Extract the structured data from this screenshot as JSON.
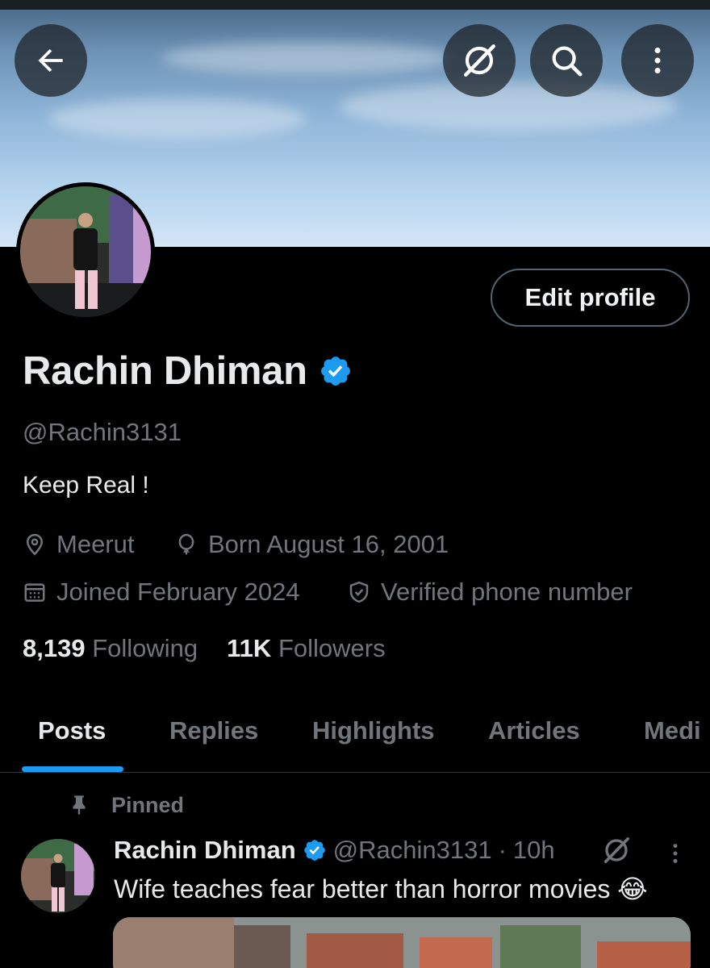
{
  "header": {
    "back_icon": "arrow-left-icon",
    "grok_icon": "grok-icon",
    "search_icon": "search-icon",
    "more_icon": "more-vertical-icon"
  },
  "profile": {
    "name": "Rachin Dhiman",
    "handle": "@Rachin3131",
    "bio": "Keep Real !",
    "location": "Meerut",
    "born": "Born August 16, 2001",
    "joined": "Joined February 2024",
    "verified_phone": "Verified phone number",
    "edit_button": "Edit profile",
    "verified_color": "#1d9bf0"
  },
  "stats": {
    "following_count": "8,139",
    "following_label": "Following",
    "followers_count": "11K",
    "followers_label": "Followers"
  },
  "tabs": [
    {
      "label": "Posts",
      "active": true
    },
    {
      "label": "Replies",
      "active": false
    },
    {
      "label": "Highlights",
      "active": false
    },
    {
      "label": "Articles",
      "active": false
    },
    {
      "label": "Medi",
      "active": false
    }
  ],
  "pinned_post": {
    "pinned_label": "Pinned",
    "author_name": "Rachin Dhiman",
    "author_handle": "@Rachin3131",
    "separator": "·",
    "time": "10h",
    "text": "Wife teaches fear better than horror movies 😂"
  },
  "colors": {
    "accent": "#1d9bf0",
    "background": "#000000",
    "muted_text": "#71767b",
    "primary_text": "#e7e9ea",
    "border": "#2f3336"
  }
}
